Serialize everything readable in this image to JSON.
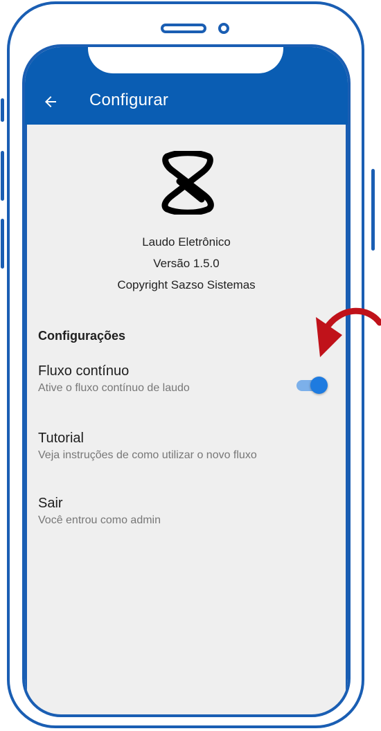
{
  "header": {
    "title": "Configurar",
    "back_icon": "arrow-left-icon"
  },
  "about": {
    "logo_icon": "sazso-logo",
    "app_name": "Laudo Eletrônico",
    "version": "Versão 1.5.0",
    "copyright": "Copyright Sazso Sistemas"
  },
  "settings": {
    "section_title": "Configurações",
    "items": [
      {
        "title": "Fluxo contínuo",
        "subtitle": "Ative o fluxo contínuo de laudo",
        "toggle_on": true
      },
      {
        "title": "Tutorial",
        "subtitle": "Veja instruções de como utilizar o novo fluxo"
      },
      {
        "title": "Sair",
        "subtitle": "Você entrou como admin"
      }
    ]
  },
  "colors": {
    "app_bar": "#0a5db3",
    "frame": "#1a5eb3",
    "background": "#efefef",
    "toggle_thumb": "#1e7be0",
    "toggle_track": "#7cb0ea",
    "annotation_arrow": "#c0121a"
  }
}
